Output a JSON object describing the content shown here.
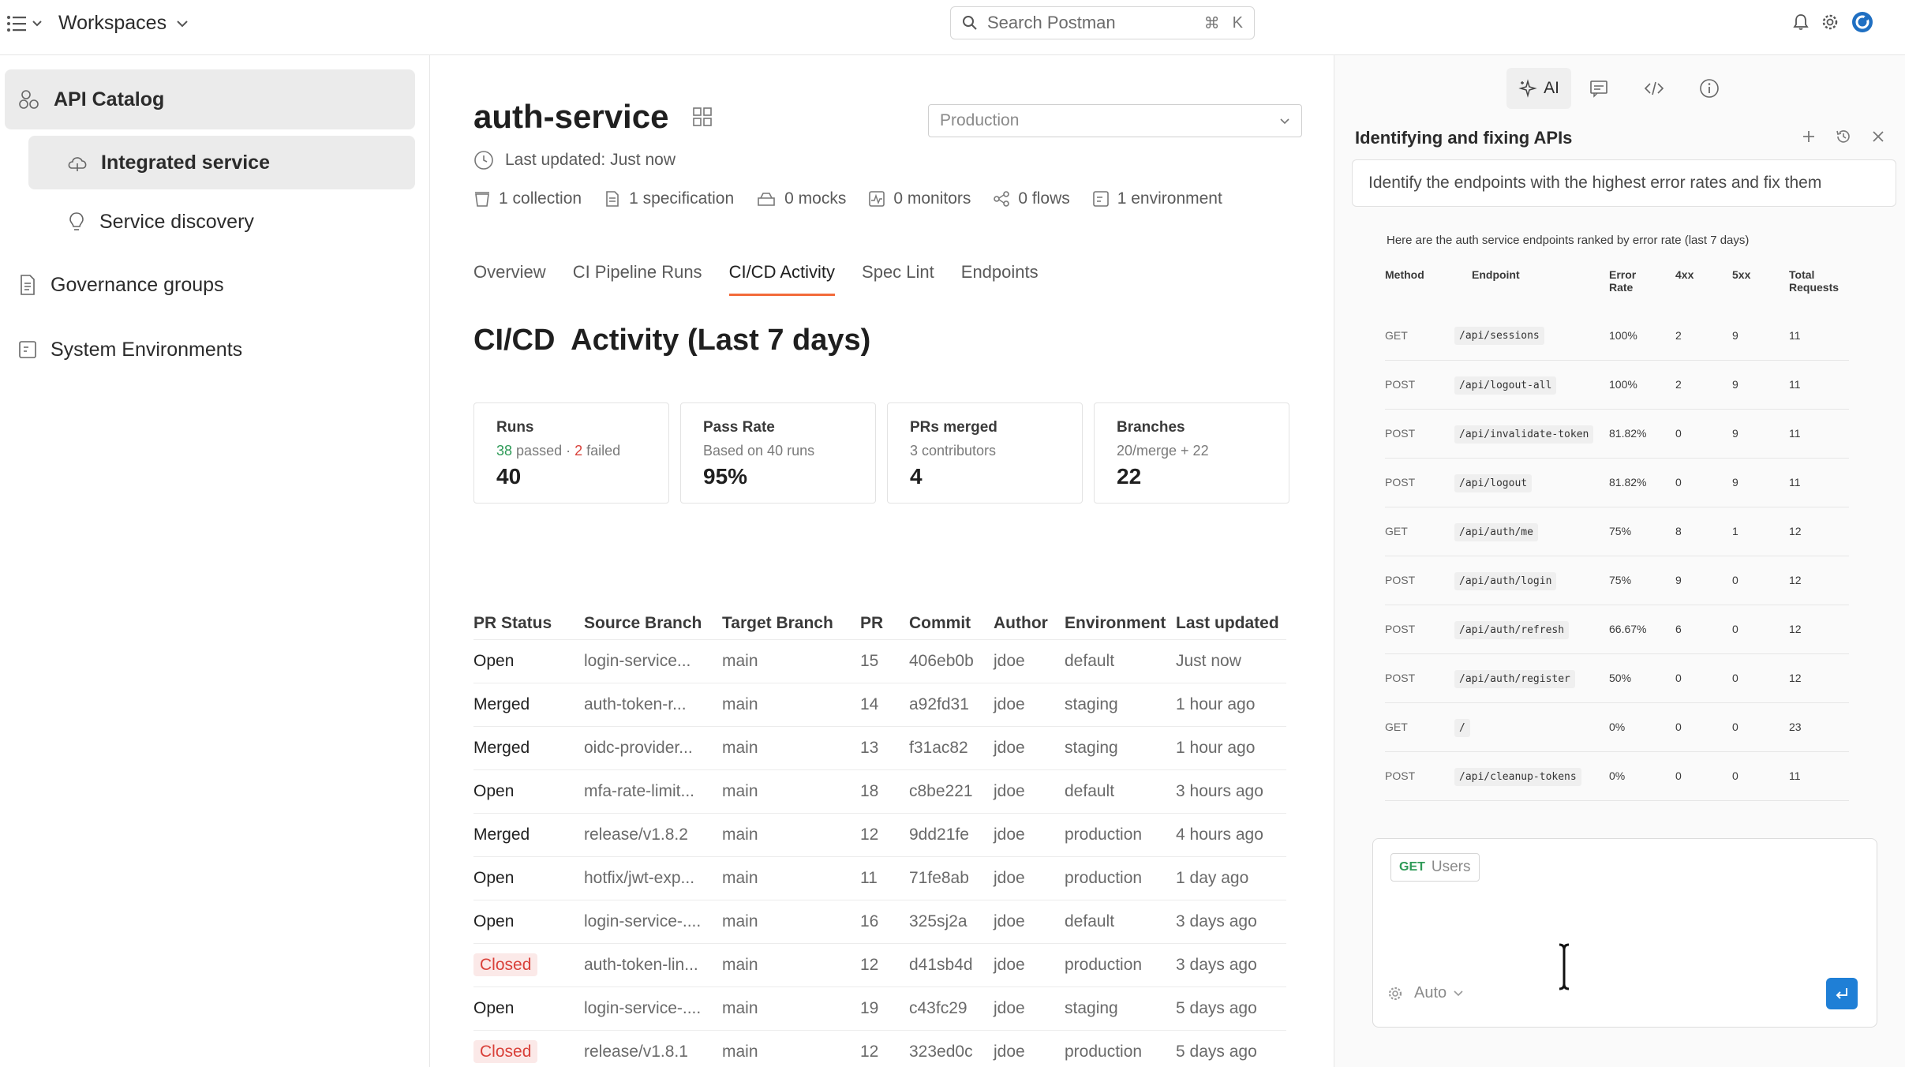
{
  "topbar": {
    "workspaces_label": "Workspaces",
    "search_placeholder": "Search Postman",
    "search_shortcut_cmd": "⌘",
    "search_shortcut_key": "K",
    "icons": [
      "menu-list-icon",
      "bell-icon",
      "gear-icon",
      "avatar"
    ]
  },
  "sidebar": {
    "items": [
      {
        "label": "API Catalog",
        "icon": "catalog-icon",
        "active": true
      },
      {
        "label": "Integrated service",
        "icon": "cloud-icon",
        "active": true
      },
      {
        "label": "Service discovery",
        "icon": "lightbulb-icon",
        "active": false
      },
      {
        "label": "Governance groups",
        "icon": "document-icon",
        "active": false
      },
      {
        "label": "System Environments",
        "icon": "environment-icon",
        "active": false
      }
    ]
  },
  "main": {
    "title": "auth-service",
    "environment_select": "Production",
    "last_updated": "Last updated: Just now",
    "meta": [
      {
        "label": "1 collection",
        "icon": "collection-icon"
      },
      {
        "label": "1 specification",
        "icon": "spec-icon"
      },
      {
        "label": "0 mocks",
        "icon": "mock-icon"
      },
      {
        "label": "0 monitors",
        "icon": "monitor-icon"
      },
      {
        "label": "0 flows",
        "icon": "flow-icon"
      },
      {
        "label": "1 environment",
        "icon": "environment-icon"
      }
    ],
    "tabs": [
      "Overview",
      "CI Pipeline Runs",
      "CI/CD Activity",
      "Spec Lint",
      "Endpoints"
    ],
    "active_tab": "CI/CD Activity",
    "section_title": "CI/CD  Activity (Last 7 days)",
    "cards": {
      "runs": {
        "title": "Runs",
        "passed_count": "38",
        "passed_label": "passed",
        "sep": "·",
        "failed_count": "2",
        "failed_label": "failed",
        "value": "40"
      },
      "pass_rate": {
        "title": "Pass Rate",
        "sub": "Based on 40 runs",
        "value": "95%"
      },
      "prs_merged": {
        "title": "PRs merged",
        "sub": "3 contributors",
        "value": "4"
      },
      "branches": {
        "title": "Branches",
        "sub": "20/merge + 22",
        "value": "22"
      }
    },
    "table": {
      "headers": [
        "PR Status",
        "Source Branch",
        "Target Branch",
        "PR",
        "Commit",
        "Author",
        "Environment",
        "Last updated"
      ],
      "rows": [
        [
          "Open",
          "login-service...",
          "main",
          "15",
          "406eb0b",
          "jdoe",
          "default",
          "Just now"
        ],
        [
          "Merged",
          "auth-token-r...",
          "main",
          "14",
          "a92fd31",
          "jdoe",
          "staging",
          "1 hour ago"
        ],
        [
          "Merged",
          "oidc-provider...",
          "main",
          "13",
          "f31ac82",
          "jdoe",
          "staging",
          "1 hour ago"
        ],
        [
          "Open",
          "mfa-rate-limit...",
          "main",
          "18",
          "c8be221",
          "jdoe",
          "default",
          "3 hours ago"
        ],
        [
          "Merged",
          "release/v1.8.2",
          "main",
          "12",
          "9dd21fe",
          "jdoe",
          "production",
          "4 hours ago"
        ],
        [
          "Open",
          "hotfix/jwt-exp...",
          "main",
          "11",
          "71fe8ab",
          "jdoe",
          "production",
          "1 day ago"
        ],
        [
          "Open",
          "login-service-....",
          "main",
          "16",
          "325sj2a",
          "jdoe",
          "default",
          "3 days ago"
        ],
        [
          "Closed",
          "auth-token-lin...",
          "main",
          "12",
          "d41sb4d",
          "jdoe",
          "production",
          "3 days ago"
        ],
        [
          "Open",
          "login-service-....",
          "main",
          "19",
          "c43fc29",
          "jdoe",
          "staging",
          "5 days ago"
        ],
        [
          "Closed",
          "release/v1.8.1",
          "main",
          "12",
          "323ed0c",
          "jdoe",
          "production",
          "5 days ago"
        ]
      ]
    }
  },
  "ai_panel": {
    "tab_ai_label": "AI",
    "title": "Identifying and fixing APIs",
    "prompt": "Identify the endpoints with the highest error rates and fix them",
    "intro": "Here are the auth service endpoints ranked by error rate (last 7 days)",
    "headers": {
      "method": "Method",
      "endpoint": "Endpoint",
      "error_rate_1": "Error",
      "error_rate_2": "Rate",
      "c4xx": "4xx",
      "c5xx": "5xx",
      "total_1": "Total",
      "total_2": "Requests"
    },
    "rows": [
      [
        "GET",
        "/api/sessions",
        "100%",
        "2",
        "9",
        "11"
      ],
      [
        "POST",
        "/api/logout-all",
        "100%",
        "2",
        "9",
        "11"
      ],
      [
        "POST",
        "/api/invalidate-token",
        "81.82%",
        "0",
        "9",
        "11"
      ],
      [
        "POST",
        "/api/logout",
        "81.82%",
        "0",
        "9",
        "11"
      ],
      [
        "GET",
        "/api/auth/me",
        "75%",
        "8",
        "1",
        "12"
      ],
      [
        "POST",
        "/api/auth/login",
        "75%",
        "9",
        "0",
        "12"
      ],
      [
        "POST",
        "/api/auth/refresh",
        "66.67%",
        "6",
        "0",
        "12"
      ],
      [
        "POST",
        "/api/auth/register",
        "50%",
        "0",
        "0",
        "12"
      ],
      [
        "GET",
        "/",
        "0%",
        "0",
        "0",
        "23"
      ],
      [
        "POST",
        "/api/cleanup-tokens",
        "0%",
        "0",
        "0",
        "11"
      ]
    ],
    "composer": {
      "chip_method": "GET",
      "chip_name": "Users",
      "mode": "Auto"
    }
  },
  "colors": {
    "accent_tab": "#f26b3a",
    "success": "#2e9a57",
    "danger": "#d9413a",
    "send_button": "#1f7fd6"
  }
}
